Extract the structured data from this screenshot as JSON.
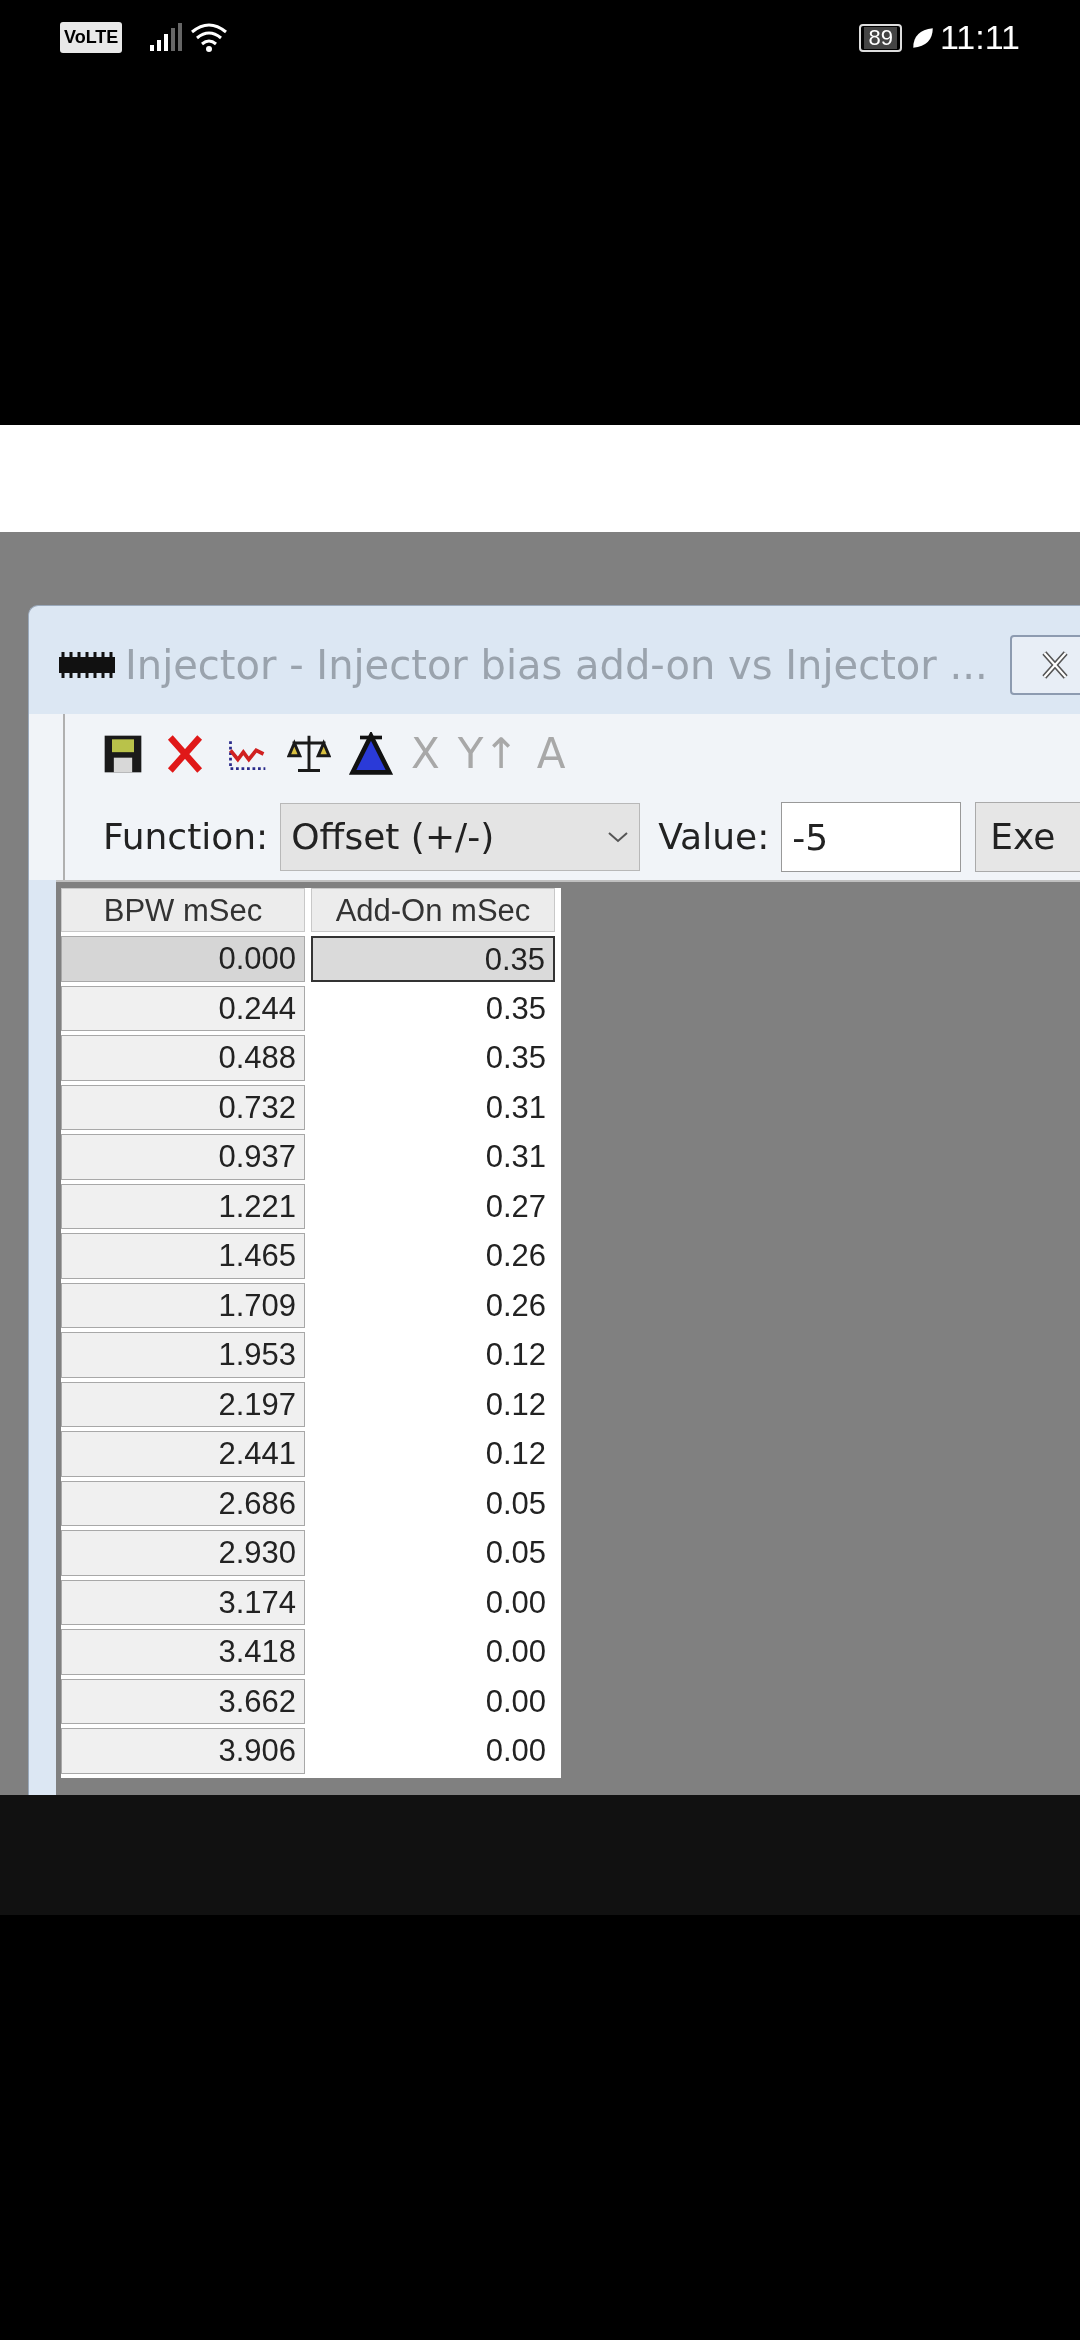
{
  "status_bar": {
    "network_badge": "VoLTE",
    "battery": "89",
    "time": "11:11"
  },
  "window": {
    "title": "Injector - Injector bias add-on vs Injector ...",
    "active": false
  },
  "toolbar": [
    {
      "kind": "save",
      "disabled": false
    },
    {
      "kind": "delete",
      "disabled": false
    },
    {
      "kind": "graph",
      "disabled": false
    },
    {
      "kind": "balance",
      "disabled": false
    },
    {
      "kind": "triangle",
      "disabled": false
    },
    {
      "kind": "glyph",
      "glyph": "X",
      "disabled": true
    },
    {
      "kind": "glyph",
      "glyph": "Y↑",
      "disabled": true
    },
    {
      "kind": "glyph",
      "glyph": "A",
      "disabled": true
    }
  ],
  "function_bar": {
    "function_label": "Function:",
    "function_value": "Offset (+/-)",
    "value_label": "Value:",
    "value": "-5",
    "execute_button": "Exe"
  },
  "table": {
    "columns": [
      "BPW mSec",
      "Add-On mSec"
    ],
    "rows": [
      {
        "bpw": "0.000",
        "add_on": "0.35",
        "selected": true
      },
      {
        "bpw": "0.244",
        "add_on": "0.35",
        "selected": false
      },
      {
        "bpw": "0.488",
        "add_on": "0.35",
        "selected": false
      },
      {
        "bpw": "0.732",
        "add_on": "0.31",
        "selected": false
      },
      {
        "bpw": "0.937",
        "add_on": "0.31",
        "selected": false
      },
      {
        "bpw": "1.221",
        "add_on": "0.27",
        "selected": false
      },
      {
        "bpw": "1.465",
        "add_on": "0.26",
        "selected": false
      },
      {
        "bpw": "1.709",
        "add_on": "0.26",
        "selected": false
      },
      {
        "bpw": "1.953",
        "add_on": "0.12",
        "selected": false
      },
      {
        "bpw": "2.197",
        "add_on": "0.12",
        "selected": false
      },
      {
        "bpw": "2.441",
        "add_on": "0.12",
        "selected": false
      },
      {
        "bpw": "2.686",
        "add_on": "0.05",
        "selected": false
      },
      {
        "bpw": "2.930",
        "add_on": "0.05",
        "selected": false
      },
      {
        "bpw": "3.174",
        "add_on": "0.00",
        "selected": false
      },
      {
        "bpw": "3.418",
        "add_on": "0.00",
        "selected": false
      },
      {
        "bpw": "3.662",
        "add_on": "0.00",
        "selected": false
      },
      {
        "bpw": "3.906",
        "add_on": "0.00",
        "selected": false
      }
    ]
  }
}
